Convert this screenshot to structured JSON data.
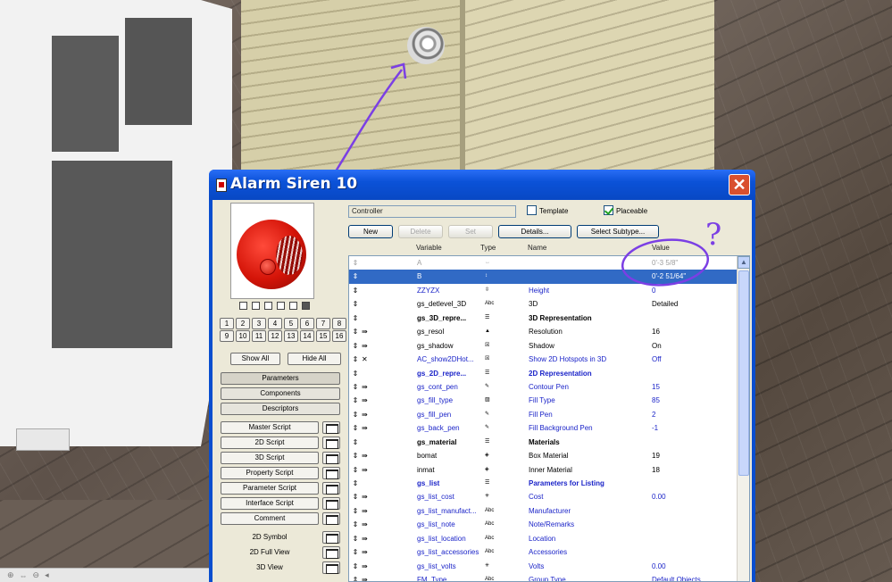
{
  "dialog": {
    "title": "Alarm Siren 10",
    "close_glyph": "✕"
  },
  "controller_field": {
    "value": "Controller"
  },
  "checkboxes": {
    "template_label": "Template",
    "template_checked": false,
    "placeable_label": "Placeable",
    "placeable_checked": true
  },
  "toolbar": {
    "new": "New",
    "delete": "Delete",
    "set": "Set",
    "details": "Details...",
    "select_subtype": "Select Subtype..."
  },
  "columns": {
    "variable": "Variable",
    "type": "Type",
    "name": "Name",
    "value": "Value"
  },
  "left_panel": {
    "view_icons": [
      "wireframe-icon",
      "hidden-line-icon",
      "shaded-icon",
      "box-icon",
      "solid-icon",
      "film-icon"
    ],
    "numbers": [
      "1",
      "2",
      "3",
      "4",
      "5",
      "6",
      "7",
      "8",
      "9",
      "10",
      "11",
      "12",
      "13",
      "14",
      "15",
      "16"
    ],
    "show_all": "Show All",
    "hide_all": "Hide All",
    "tabs": [
      "Parameters",
      "Components",
      "Descriptors"
    ],
    "scripts": [
      "Master Script",
      "2D Script",
      "3D Script",
      "Property Script",
      "Parameter Script",
      "Interface Script",
      "Comment"
    ],
    "views": [
      "2D Symbol",
      "2D Full View",
      "3D View"
    ]
  },
  "rows": [
    {
      "hand": "⇕",
      "flag": "",
      "var": "A",
      "type": "↔",
      "name": "",
      "val": "0'-3 5/8\"",
      "style": "gray"
    },
    {
      "hand": "⇕",
      "flag": "",
      "var": "B",
      "type": "↕",
      "name": "",
      "val": "0'-2 51/64\"",
      "style": "selected"
    },
    {
      "hand": "⇕",
      "flag": "",
      "var": "ZZYZX",
      "type": "⇳",
      "name": "Height",
      "val": "0",
      "style": "blue"
    },
    {
      "hand": "⇕",
      "flag": "",
      "var": "gs_detlevel_3D",
      "type": "Abc",
      "name": "3D",
      "val": "Detailed",
      "style": ""
    },
    {
      "hand": "⇕",
      "flag": "",
      "var": "gs_3D_repre...",
      "type": "☰",
      "name": "3D Representation",
      "val": "",
      "style": "bold"
    },
    {
      "hand": "⇕",
      "flag": "⇛",
      "var": "gs_resol",
      "type": "▲",
      "name": "Resolution",
      "val": "16",
      "style": ""
    },
    {
      "hand": "⇕",
      "flag": "⇛",
      "var": "gs_shadow",
      "type": "☒",
      "name": "Shadow",
      "val": "On",
      "style": ""
    },
    {
      "hand": "⇕",
      "flag": "✕",
      "var": "AC_show2DHot...",
      "type": "☒",
      "name": "Show 2D Hotspots in 3D",
      "val": "Off",
      "style": "blue"
    },
    {
      "hand": "⇕",
      "flag": "",
      "var": "gs_2D_repre...",
      "type": "☰",
      "name": "2D Representation",
      "val": "",
      "style": "boldblue"
    },
    {
      "hand": "⇕",
      "flag": "⇛",
      "var": "gs_cont_pen",
      "type": "✎",
      "name": "Contour Pen",
      "val": "15",
      "style": "blue"
    },
    {
      "hand": "⇕",
      "flag": "⇛",
      "var": "gs_fill_type",
      "type": "▨",
      "name": "Fill Type",
      "val": "85",
      "style": "blue"
    },
    {
      "hand": "⇕",
      "flag": "⇛",
      "var": "gs_fill_pen",
      "type": "✎",
      "name": "Fill Pen",
      "val": "2",
      "style": "blue"
    },
    {
      "hand": "⇕",
      "flag": "⇛",
      "var": "gs_back_pen",
      "type": "✎",
      "name": "Fill Background Pen",
      "val": "-1",
      "style": "blue"
    },
    {
      "hand": "⇕",
      "flag": "",
      "var": "gs_material",
      "type": "☰",
      "name": "Materials",
      "val": "",
      "style": "bold"
    },
    {
      "hand": "⇕",
      "flag": "⇛",
      "var": "bomat",
      "type": "◈",
      "name": "Box Material",
      "val": "19",
      "style": ""
    },
    {
      "hand": "⇕",
      "flag": "⇛",
      "var": "inmat",
      "type": "◈",
      "name": "Inner Material",
      "val": "18",
      "style": ""
    },
    {
      "hand": "⇕",
      "flag": "",
      "var": "gs_list",
      "type": "☰",
      "name": "Parameters for Listing",
      "val": "",
      "style": "boldblue"
    },
    {
      "hand": "⇕",
      "flag": "⇛",
      "var": "gs_list_cost",
      "type": "✳",
      "name": "Cost",
      "val": "0.00",
      "style": "blue"
    },
    {
      "hand": "⇕",
      "flag": "⇛",
      "var": "gs_list_manufact...",
      "type": "Abc",
      "name": "Manufacturer",
      "val": "",
      "style": "blue"
    },
    {
      "hand": "⇕",
      "flag": "⇛",
      "var": "gs_list_note",
      "type": "Abc",
      "name": "Note/Remarks",
      "val": "",
      "style": "blue"
    },
    {
      "hand": "⇕",
      "flag": "⇛",
      "var": "gs_list_location",
      "type": "Abc",
      "name": "Location",
      "val": "",
      "style": "blue"
    },
    {
      "hand": "⇕",
      "flag": "⇛",
      "var": "gs_list_accessories",
      "type": "Abc",
      "name": "Accessories",
      "val": "",
      "style": "blue"
    },
    {
      "hand": "⇕",
      "flag": "⇛",
      "var": "gs_list_volts",
      "type": "✳",
      "name": "Volts",
      "val": "0.00",
      "style": "blue"
    },
    {
      "hand": "⇕",
      "flag": "⇛",
      "var": "FM_Type",
      "type": "Abc",
      "name": "Group Type",
      "val": "Default Objects",
      "style": "blue"
    }
  ],
  "annotation": {
    "question_mark": "?"
  },
  "colors": {
    "title_blue": "#0b52d8",
    "selection": "#316ac5",
    "parameter_blue": "#1a23c8",
    "annotation_purple": "#7b3fe4",
    "siren_red": "#d41408"
  }
}
